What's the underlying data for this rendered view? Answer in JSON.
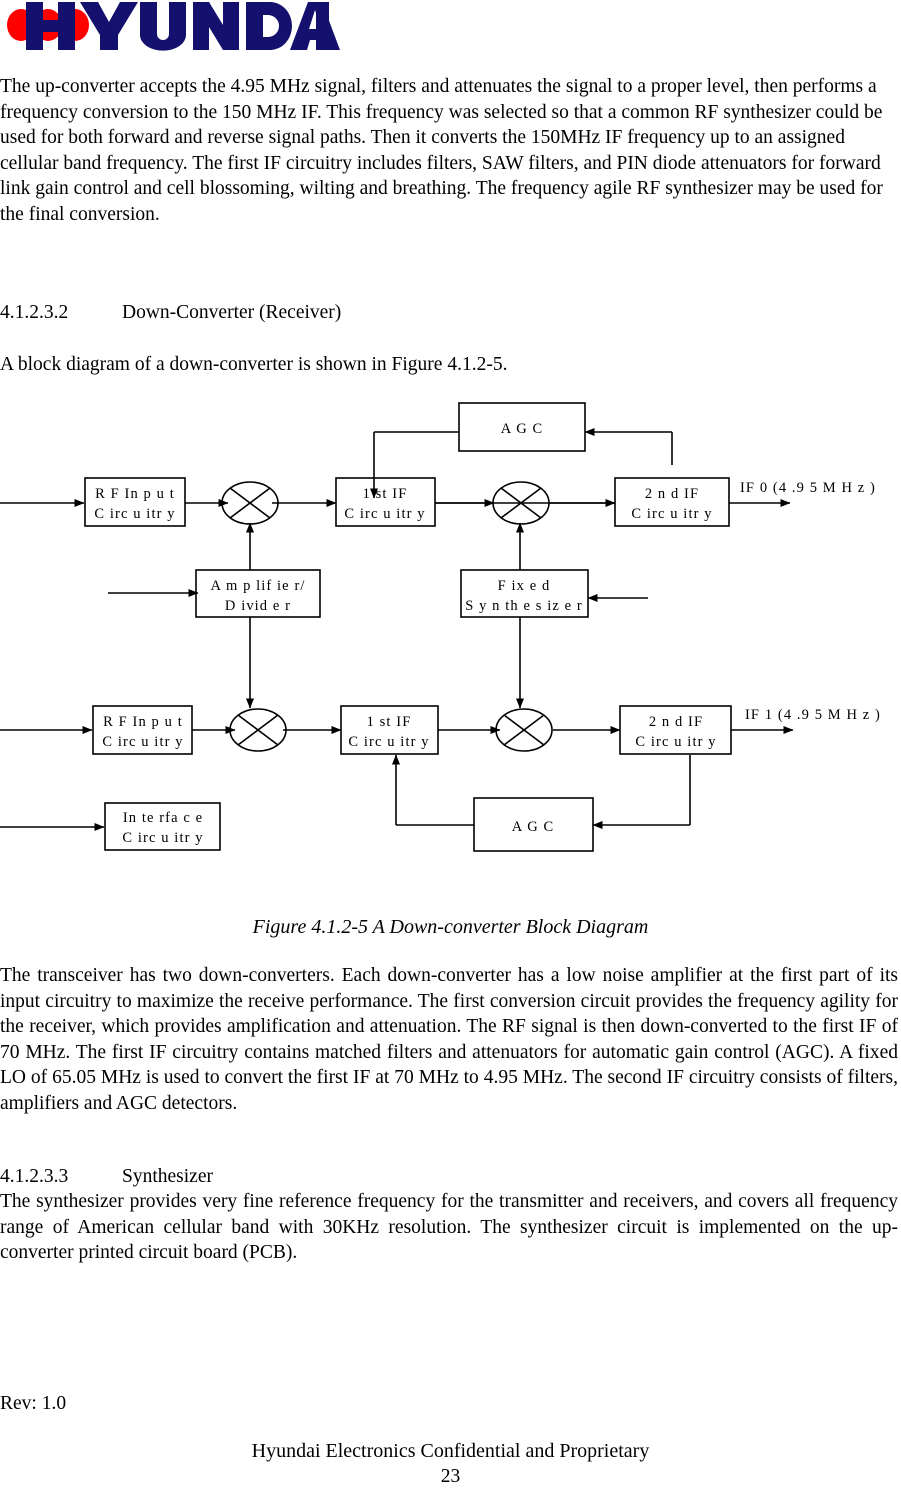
{
  "logo": {
    "brand": "HYUNDAI",
    "dot_color": "#ff0000",
    "word_color": "#13106e"
  },
  "body": {
    "paragraph_1": "The up-converter accepts the 4.95 MHz signal, filters and attenuates the signal to a proper level, then performs a frequency conversion to the 150 MHz IF. This frequency was selected so that a common RF synthesizer could be used for both forward and reverse signal paths. Then it converts the 150MHz IF frequency up to an assigned cellular band frequency. The first IF circuitry includes filters, SAW filters, and PIN diode attenuators for forward link gain control and cell blossoming, wilting and breathing.  The frequency agile RF synthesizer may be used for the final conversion.",
    "heading_1_number": "4.1.2.3.2",
    "heading_1_title": "Down-Converter (Receiver)",
    "paragraph_2": "A block diagram of a down-converter is shown in Figure 4.1.2-5.",
    "figure_caption": "Figure  4.1.2-5 A Down-converter Block Diagram",
    "paragraph_3": "The transceiver has two down-converters. Each down-converter has a low noise amplifier at the first part of its input circuitry to maximize the receive performance. The first conversion circuit provides the frequency agility for the receiver, which provides amplification and attenuation.  The RF signal is then down-converted to the first IF of 70 MHz. The first IF circuitry contains matched filters and attenuators for automatic gain control (AGC).  A fixed LO of 65.05 MHz is used to convert the first IF at 70 MHz to 4.95 MHz. The second IF circuitry consists of filters, amplifiers and AGC detectors.",
    "heading_2_number": "4.1.2.3.3",
    "heading_2_title": "Synthesizer",
    "paragraph_4": "The synthesizer provides very fine reference frequency for the transmitter and receivers, and covers all frequency range of American cellular band with 30KHz resolution. The synthesizer circuit is implemented on the up-converter printed circuit board (PCB)."
  },
  "footer": {
    "revision": "Rev: 1.0",
    "confidential": "Hyundai Electronics Confidential and Proprietary",
    "page_number": "23"
  },
  "diagram": {
    "blocks": {
      "agc_top": "A G C",
      "rf_input_top_line1": "R F  In p u t",
      "rf_input_top_line2": "C irc u itr y",
      "if1_top_line1": "1 st IF",
      "if1_top_line2": "C irc u itr y",
      "if2_top_line1": "2 n d  IF",
      "if2_top_line2": "C irc u itr y",
      "amplifier_line1": "A m p lif ie r/",
      "amplifier_line2": "D ivid e r",
      "synth_line1": "F ix e d",
      "synth_line2": "S y n th e s iz e r",
      "rf_input_bot_line1": "R F  In p u t",
      "rf_input_bot_line2": "C irc u itr y",
      "if1_bot_line1": "1 st IF",
      "if1_bot_line2": "C irc u itr y",
      "if2_bot_line1": "2 n d  IF",
      "if2_bot_line2": "C irc u itr y",
      "interface_line1": "In te rfa c e",
      "interface_line2": "C irc u itr y",
      "agc_bottom": "A G C"
    },
    "signals": {
      "if0_out": "IF 0  (4 .9 5  M H z )",
      "if1_out": "IF 1  (4 .9 5  M H z )"
    }
  }
}
